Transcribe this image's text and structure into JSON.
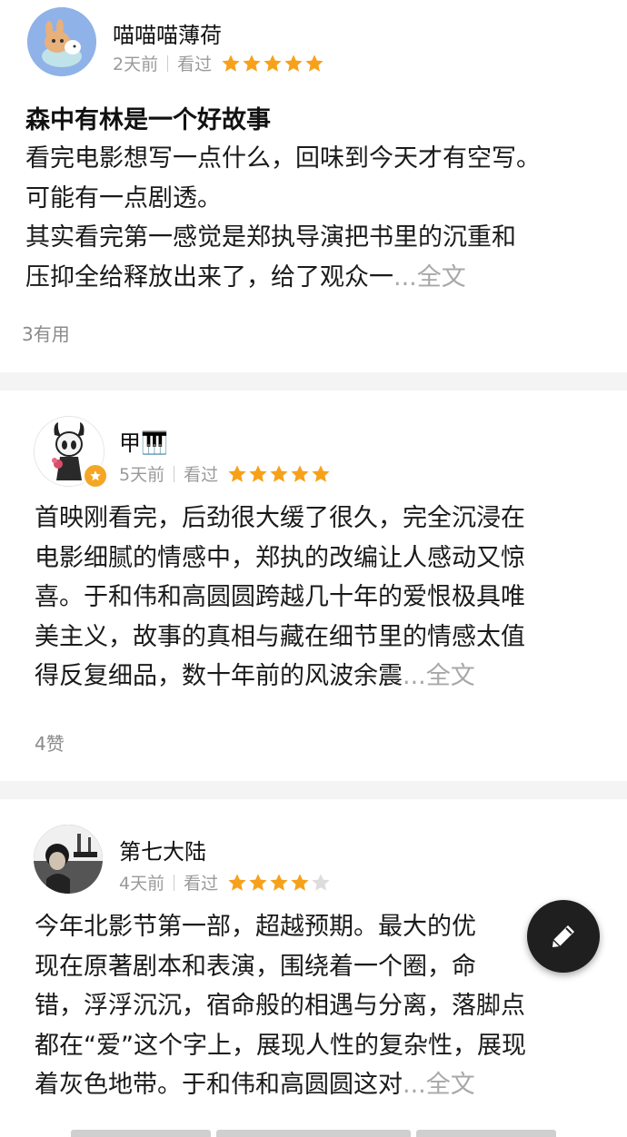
{
  "reviews": [
    {
      "user": "喵喵喵薄荷",
      "time": "2天前",
      "status": "看过",
      "rating": 5,
      "title": "森中有林是一个好故事",
      "lines": [
        "看完电影想写一点什么，回味到今天才有空写。",
        "可能有一点剧透。",
        "其实看完第一感觉是郑执导演把书里的沉重和",
        "压抑全给释放出来了，给了观众一"
      ],
      "ellipsis": "...",
      "more": "全文",
      "useful": "3有用"
    },
    {
      "user": "甲🎹",
      "time": "5天前",
      "status": "看过",
      "rating": 5,
      "lines": [
        "首映刚看完，后劲很大缓了很久，完全沉浸在",
        "电影细腻的情感中，郑执的改编让人感动又惊",
        "喜。于和伟和高圆圆跨越几十年的爱恨极具唯",
        "美主义，故事的真相与藏在细节里的情感太值",
        "得反复细品，数十年前的风波余震"
      ],
      "ellipsis": "...",
      "more": "全文",
      "useful": "4赞"
    },
    {
      "user": "第七大陆",
      "time": "4天前",
      "status": "看过",
      "rating": 4,
      "lines": [
        "今年北影节第一部，超越预期。最大的优",
        "现在原著剧本和表演，围绕着一个圈，命",
        "错，浮浮沉沉，宿命般的相遇与分离，落脚点",
        "都在“爱”这个字上，展现人性的复杂性，展现",
        "着灰色地带。于和伟和高圆圆这对"
      ],
      "ellipsis": "...",
      "more": "全文"
    }
  ],
  "fab": {
    "icon": "pen-icon"
  },
  "colors": {
    "star_filled": "#f7a11a",
    "star_empty": "#dddddd",
    "muted_text": "#9a9a9a",
    "fab_bg": "#1f1f1f"
  }
}
